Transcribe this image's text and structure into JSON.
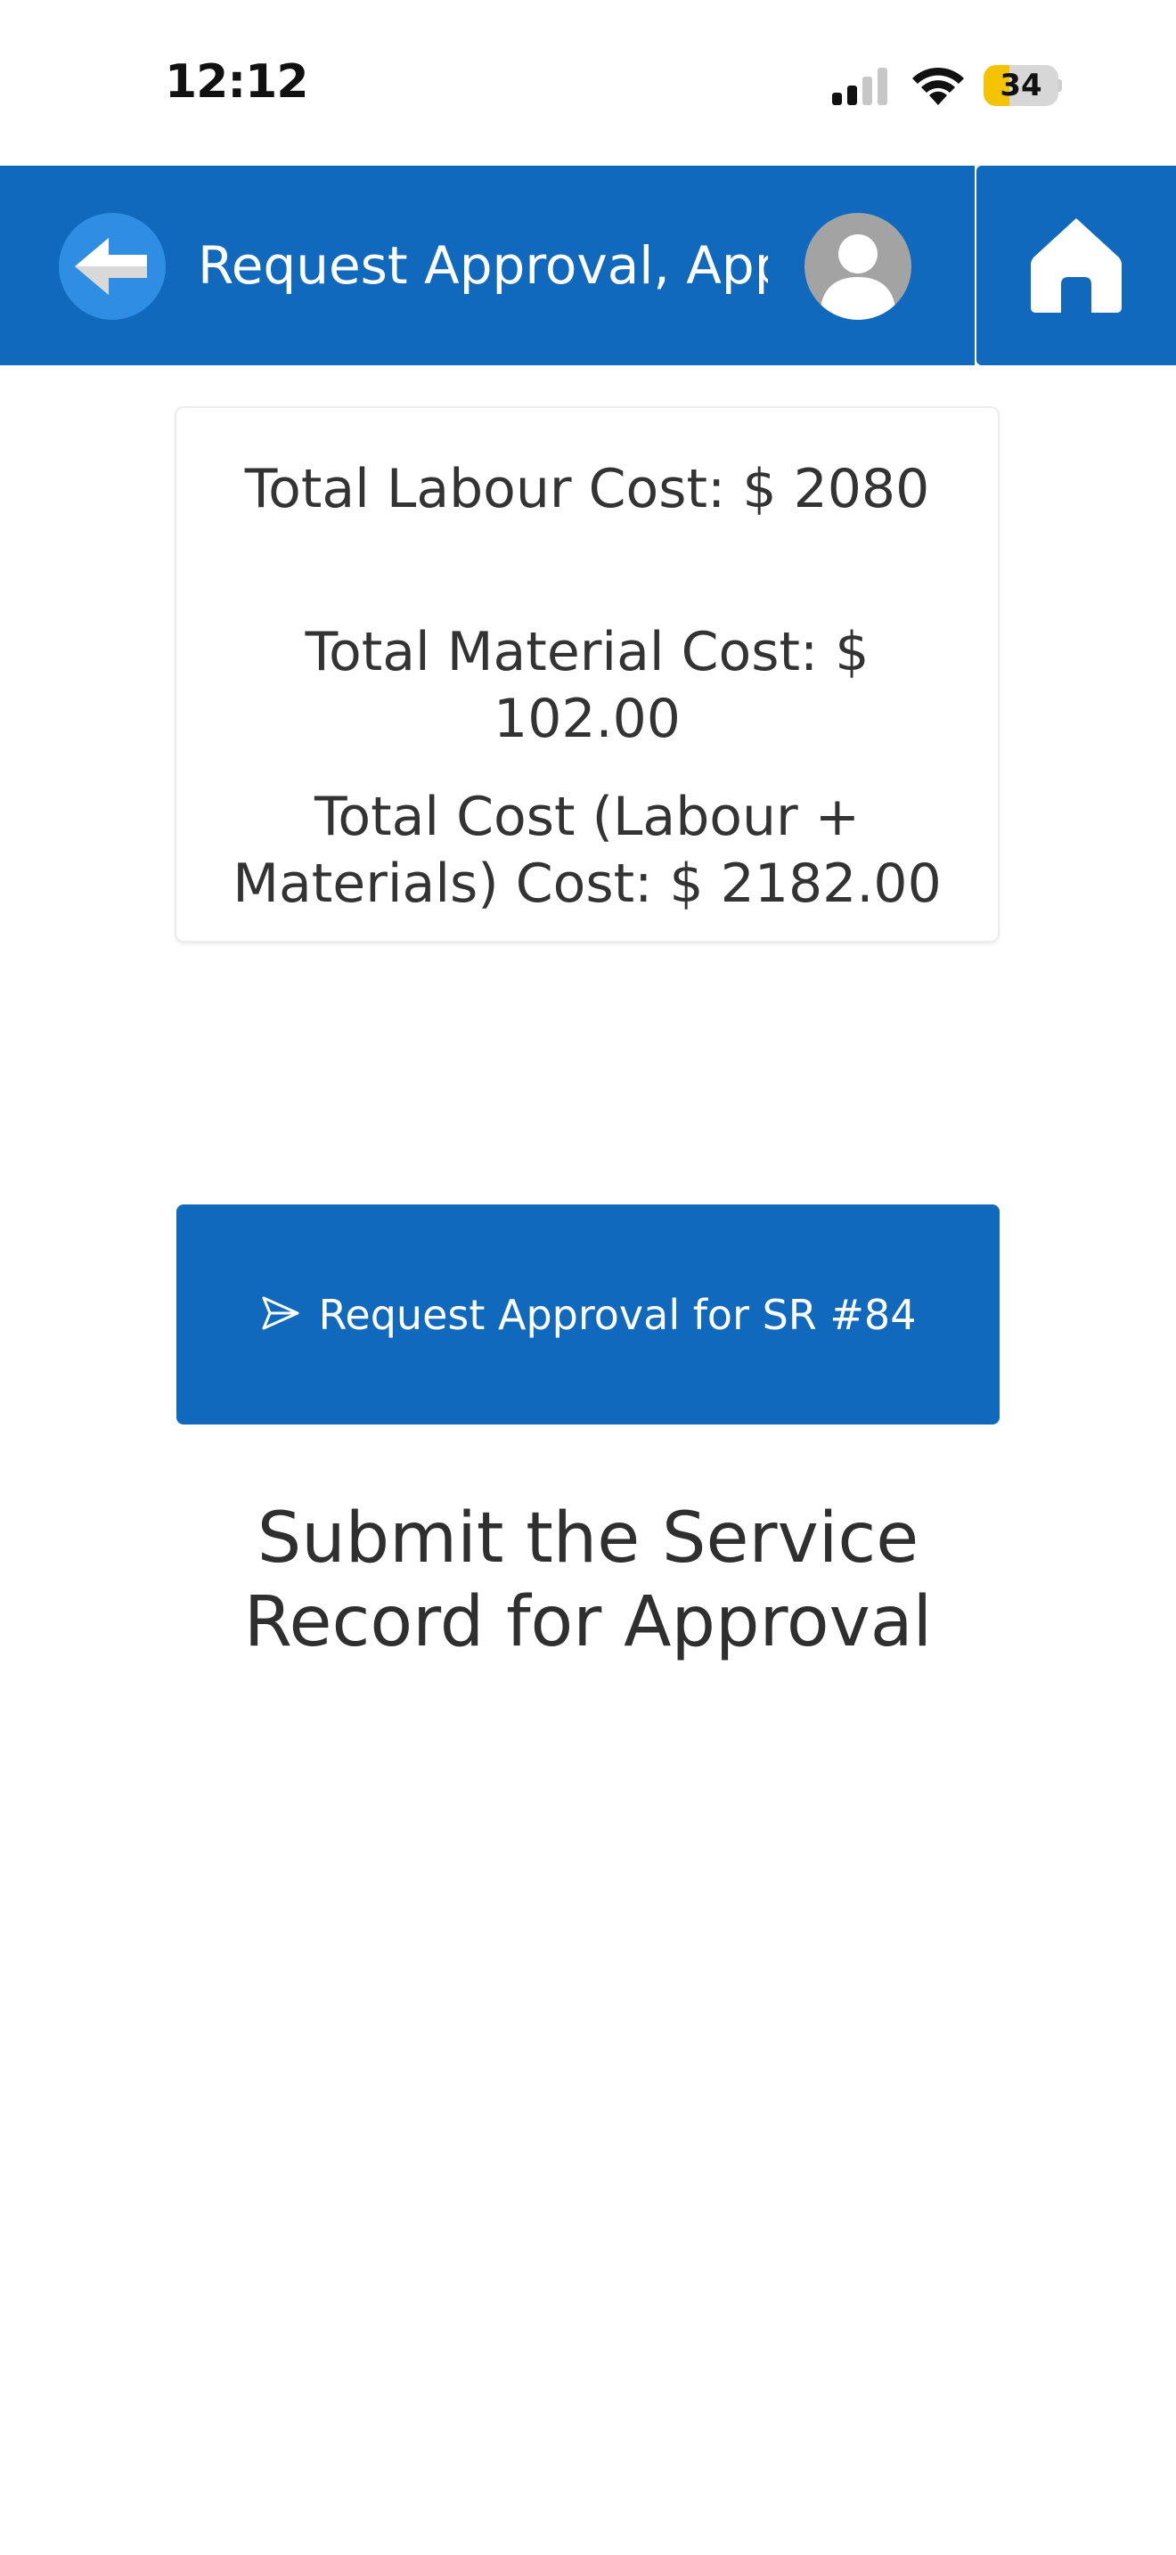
{
  "status_bar": {
    "time": "12:12",
    "battery_level": "34",
    "battery_fraction": 0.34,
    "icons": [
      "signal-icon",
      "wifi-icon",
      "battery-icon"
    ]
  },
  "header": {
    "title": "Request Approval, Approve",
    "back_icon": "arrow-left-icon",
    "avatar_icon": "user-avatar-icon",
    "home_icon": "home-icon"
  },
  "costs": {
    "labour": "Total Labour Cost: $ 2080",
    "material": "Total Material Cost: $ 102.00",
    "total": "Total Cost (Labour + Materials) Cost:  $ 2182.00"
  },
  "actions": {
    "request_approval_label": "Request Approval for SR #84",
    "request_icon": "send-icon"
  },
  "main": {
    "submit_heading": "Submit the Service Record for Approval"
  },
  "colors": {
    "primary": "#1169bd",
    "back_button": "#2f8de4",
    "avatar": "#a3a3a3",
    "battery": "#f5c400",
    "text": "#333333"
  }
}
